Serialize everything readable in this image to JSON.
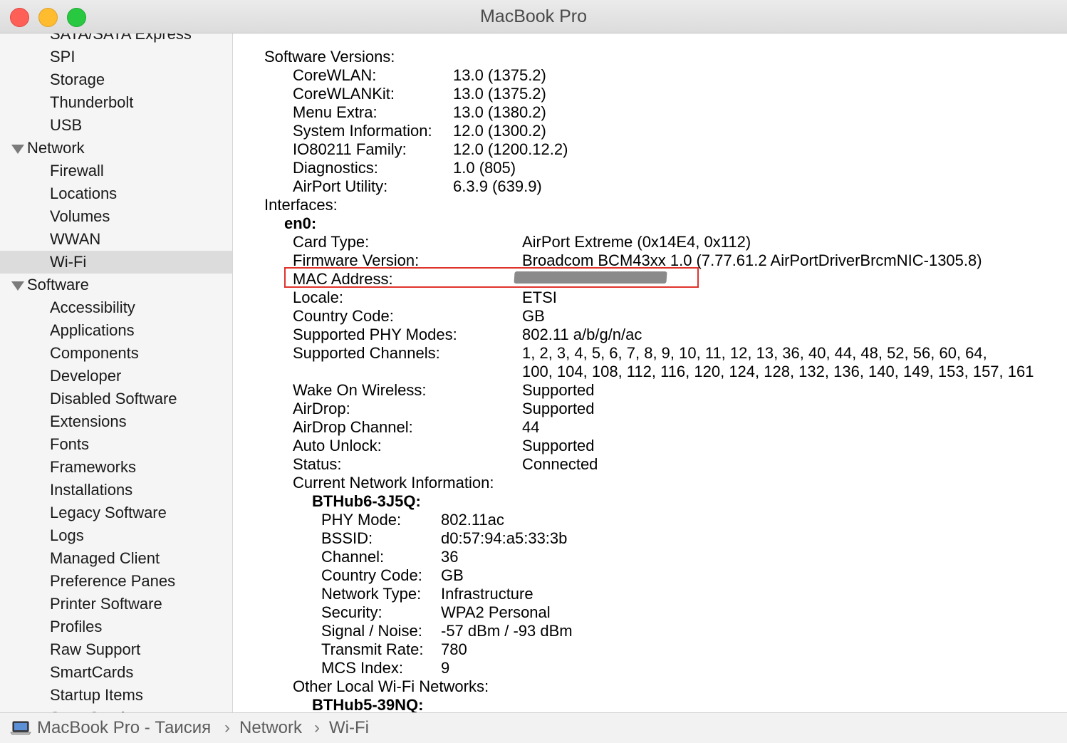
{
  "window": {
    "title": "MacBook Pro"
  },
  "sidebar": {
    "items": [
      {
        "label": "SATA/SATA Express",
        "kind": "child"
      },
      {
        "label": "SPI",
        "kind": "child"
      },
      {
        "label": "Storage",
        "kind": "child"
      },
      {
        "label": "Thunderbolt",
        "kind": "child"
      },
      {
        "label": "USB",
        "kind": "child"
      },
      {
        "label": "Network",
        "kind": "group"
      },
      {
        "label": "Firewall",
        "kind": "child"
      },
      {
        "label": "Locations",
        "kind": "child"
      },
      {
        "label": "Volumes",
        "kind": "child"
      },
      {
        "label": "WWAN",
        "kind": "child"
      },
      {
        "label": "Wi-Fi",
        "kind": "child",
        "selected": true
      },
      {
        "label": "Software",
        "kind": "group"
      },
      {
        "label": "Accessibility",
        "kind": "child"
      },
      {
        "label": "Applications",
        "kind": "child"
      },
      {
        "label": "Components",
        "kind": "child"
      },
      {
        "label": "Developer",
        "kind": "child"
      },
      {
        "label": "Disabled Software",
        "kind": "child"
      },
      {
        "label": "Extensions",
        "kind": "child"
      },
      {
        "label": "Fonts",
        "kind": "child"
      },
      {
        "label": "Frameworks",
        "kind": "child"
      },
      {
        "label": "Installations",
        "kind": "child"
      },
      {
        "label": "Legacy Software",
        "kind": "child"
      },
      {
        "label": "Logs",
        "kind": "child"
      },
      {
        "label": "Managed Client",
        "kind": "child"
      },
      {
        "label": "Preference Panes",
        "kind": "child"
      },
      {
        "label": "Printer Software",
        "kind": "child"
      },
      {
        "label": "Profiles",
        "kind": "child"
      },
      {
        "label": "Raw Support",
        "kind": "child"
      },
      {
        "label": "SmartCards",
        "kind": "child"
      },
      {
        "label": "Startup Items",
        "kind": "child"
      },
      {
        "label": "Sync Services",
        "kind": "child"
      }
    ]
  },
  "content": {
    "software_versions": {
      "heading": "Software Versions:",
      "rows": [
        {
          "key": "CoreWLAN:",
          "value": "13.0 (1375.2)"
        },
        {
          "key": "CoreWLANKit:",
          "value": "13.0 (1375.2)"
        },
        {
          "key": "Menu Extra:",
          "value": "13.0 (1380.2)"
        },
        {
          "key": "System Information:",
          "value": "12.0 (1300.2)"
        },
        {
          "key": "IO80211 Family:",
          "value": "12.0 (1200.12.2)"
        },
        {
          "key": "Diagnostics:",
          "value": "1.0 (805)"
        },
        {
          "key": "AirPort Utility:",
          "value": "6.3.9 (639.9)"
        }
      ]
    },
    "interfaces_heading": "Interfaces:",
    "interface_name": "en0:",
    "interface_rows": [
      {
        "key": "Card Type:",
        "value": "AirPort Extreme  (0x14E4, 0x112)"
      },
      {
        "key": "Firmware Version:",
        "value": "Broadcom BCM43xx 1.0 (7.77.61.2 AirPortDriverBrcmNIC-1305.8)"
      },
      {
        "key": "MAC Address:",
        "value": ""
      },
      {
        "key": "Locale:",
        "value": "ETSI"
      },
      {
        "key": "Country Code:",
        "value": "GB"
      },
      {
        "key": "Supported PHY Modes:",
        "value": "802.11 a/b/g/n/ac"
      },
      {
        "key": "Supported Channels:",
        "value": "1, 2, 3, 4, 5, 6, 7, 8, 9, 10, 11, 12, 13, 36, 40, 44, 48, 52, 56, 60, 64,",
        "value2": "100, 104, 108, 112, 116, 120, 124, 128, 132, 136, 140, 149, 153, 157, 161"
      },
      {
        "key": "Wake On Wireless:",
        "value": "Supported"
      },
      {
        "key": "AirDrop:",
        "value": "Supported"
      },
      {
        "key": "AirDrop Channel:",
        "value": "44"
      },
      {
        "key": "Auto Unlock:",
        "value": "Supported"
      },
      {
        "key": "Status:",
        "value": "Connected"
      }
    ],
    "current_network_heading": "Current Network Information:",
    "current_network_name": "BTHub6-3J5Q:",
    "current_network_rows": [
      {
        "key": "PHY Mode:",
        "value": "802.11ac"
      },
      {
        "key": "BSSID:",
        "value": "d0:57:94:a5:33:3b"
      },
      {
        "key": "Channel:",
        "value": "36"
      },
      {
        "key": "Country Code:",
        "value": "GB"
      },
      {
        "key": "Network Type:",
        "value": "Infrastructure"
      },
      {
        "key": "Security:",
        "value": "WPA2 Personal"
      },
      {
        "key": "Signal / Noise:",
        "value": "-57 dBm / -93 dBm"
      },
      {
        "key": "Transmit Rate:",
        "value": "780"
      },
      {
        "key": "MCS Index:",
        "value": "9"
      }
    ],
    "other_networks_heading": "Other Local Wi-Fi Networks:",
    "other_network_name": "BTHub5-39NQ:"
  },
  "statusbar": {
    "icon": "laptop-icon",
    "crumbs": [
      "MacBook Pro - Таисия",
      "Network",
      "Wi-Fi"
    ],
    "separator": "›"
  },
  "colors": {
    "highlight_box": "#e0332b",
    "sidebar_selected": "#dcdcdc"
  }
}
